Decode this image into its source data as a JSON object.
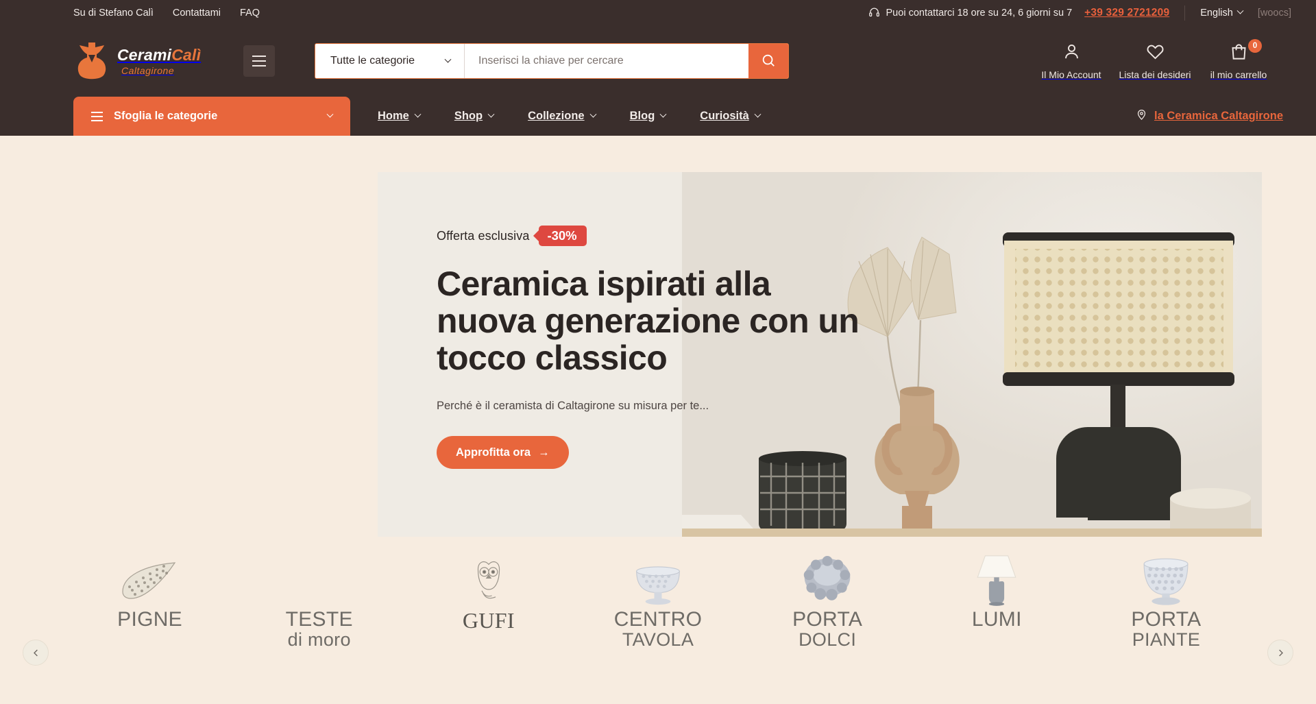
{
  "topbar": {
    "links": [
      "Su di Stefano Calì",
      "Contattami",
      "FAQ"
    ],
    "support_text": "Puoi contattarci 18 ore su 24, 6 giorni su 7",
    "phone": "+39 329 2721209",
    "language": "English",
    "currency_widget": "[woocs]",
    "headset_icon": "headset-icon"
  },
  "header": {
    "logo_main_1": "Cerami",
    "logo_main_2": "Calì",
    "logo_sub": "Caltagirone",
    "search": {
      "category_value": "Tutte le categorie",
      "placeholder": "Inserisci la chiave per cercare",
      "search_icon": "search-icon"
    },
    "actions": [
      {
        "label": "Il Mio Account",
        "icon": "user-icon"
      },
      {
        "label": "Lista dei desideri",
        "icon": "heart-icon"
      },
      {
        "label": "il mio carrello",
        "icon": "shopping-bag-icon",
        "badge": "0"
      }
    ]
  },
  "nav": {
    "browse_label": "Sfoglia le categorie",
    "items": [
      "Home",
      "Shop",
      "Collezione",
      "Blog",
      "Curiosità"
    ],
    "right_label": "la Ceramica Caltagirone",
    "right_icon": "location-pin-icon"
  },
  "hero": {
    "offer_label": "Offerta esclusiva",
    "discount": "-30%",
    "title": "Ceramica ispirati alla nuova generazione con un tocco classico",
    "subtitle": "Perché è il ceramista di Caltagirone su misura per te...",
    "cta": "Approfitta ora",
    "cta_arrow": "→",
    "slides_total": 3,
    "active_slide": 1
  },
  "categories": {
    "prev_label": "‹",
    "next_label": "›",
    "items": [
      {
        "line1": "PIGNE",
        "line2": "",
        "icon": "pinecone-icon",
        "style": "sans"
      },
      {
        "line1": "TESTE",
        "line2": "di moro",
        "icon": "moor-head-icon",
        "style": "sans"
      },
      {
        "line1": "GUFI",
        "line2": "",
        "icon": "owl-icon",
        "style": "serif"
      },
      {
        "line1": "CENTRO",
        "line2": "TAVOLA",
        "icon": "centerpiece-icon",
        "style": "sans"
      },
      {
        "line1": "PORTA",
        "line2": "DOLCI",
        "icon": "sweets-bowl-icon",
        "style": "sans"
      },
      {
        "line1": "LUMI",
        "line2": "",
        "icon": "table-lamp-icon",
        "style": "sans"
      },
      {
        "line1": "PORTA",
        "line2": "PIANTE",
        "icon": "plant-pot-icon",
        "style": "sans"
      }
    ]
  },
  "colors": {
    "dark": "#3a2e2c",
    "accent": "#e8663c",
    "badge_red": "#de4840",
    "page_bg": "#f7ece0"
  }
}
